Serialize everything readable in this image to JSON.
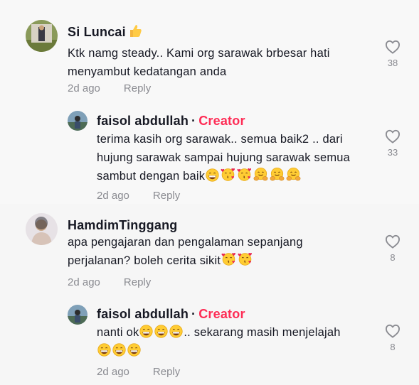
{
  "comments": [
    {
      "username": "Si Luncai",
      "username_emoji": "👍",
      "text": "Ktk namg steady.. Kami org sarawak brbesar hati menyambut kedatangan anda",
      "time": "2d ago",
      "reply_label": "Reply",
      "likes": "38",
      "replies": [
        {
          "username": "faisol abdullah",
          "separator": "·",
          "badge": "Creator",
          "text": "terima kasih org sarawak.. semua baik2 .. dari hujung sarawak sampai hujung sarawak semua sambut dengan baik",
          "emojis": [
            "grin-emoji",
            "kissing-hearts-emoji",
            "kissing-hearts-emoji",
            "hugging-emoji",
            "hugging-emoji",
            "hugging-emoji"
          ],
          "time": "2d ago",
          "reply_label": "Reply",
          "likes": "33"
        }
      ]
    },
    {
      "username": "HamdimTinggang",
      "text": "apa pengajaran dan pengalaman sepanjang perjalanan? boleh cerita sikit",
      "emojis": [
        "kissing-hearts-emoji",
        "kissing-hearts-emoji"
      ],
      "time": "2d ago",
      "reply_label": "Reply",
      "likes": "8",
      "replies": [
        {
          "username": "faisol abdullah",
          "separator": "·",
          "badge": "Creator",
          "text_before": "nanti ok",
          "emojis_inline": [
            "grin-emoji",
            "grin-emoji",
            "grin-emoji"
          ],
          "text_after": ".. sekarang masih menjelajah",
          "emojis_line2": [
            "grin-emoji",
            "grin-emoji",
            "grin-emoji"
          ],
          "time": "2d ago",
          "reply_label": "Reply",
          "likes": "8"
        }
      ]
    }
  ],
  "colors": {
    "creator": "#fe2c55",
    "meta": "#8a8b91",
    "text": "#161823"
  }
}
